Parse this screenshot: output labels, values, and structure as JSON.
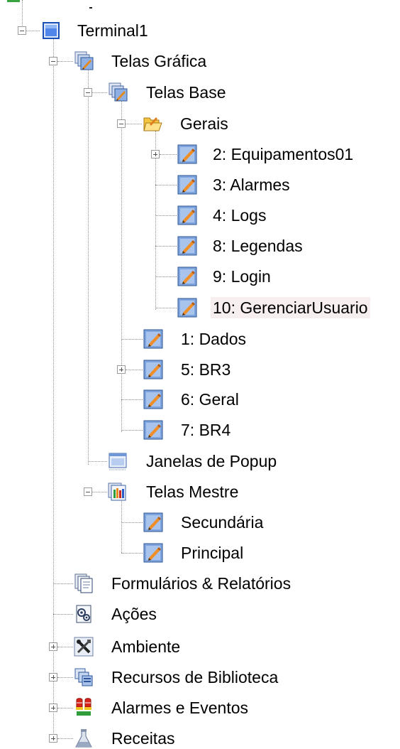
{
  "tree": {
    "root": {
      "label": "Terminal1"
    },
    "telas_grafica": {
      "label": "Telas Gráfica"
    },
    "telas_base": {
      "label": "Telas Base"
    },
    "gerais": {
      "label": "Gerais"
    },
    "items_gerais": [
      {
        "label": "2: Equipamentos01"
      },
      {
        "label": "3: Alarmes"
      },
      {
        "label": "4: Logs"
      },
      {
        "label": "8: Legendas"
      },
      {
        "label": "9: Login"
      },
      {
        "label": "10: GerenciarUsuario"
      }
    ],
    "items_base": [
      {
        "label": "1: Dados"
      },
      {
        "label": "5: BR3"
      },
      {
        "label": "6: Geral"
      },
      {
        "label": "7: BR4"
      }
    ],
    "janelas_popup": {
      "label": "Janelas de Popup"
    },
    "telas_mestre": {
      "label": "Telas Mestre"
    },
    "items_mestre": [
      {
        "label": "Secundária"
      },
      {
        "label": "Principal"
      }
    ],
    "formularios": {
      "label": "Formulários & Relatórios"
    },
    "acoes": {
      "label": "Ações"
    },
    "ambiente": {
      "label": "Ambiente"
    },
    "recursos": {
      "label": "Recursos de Biblioteca"
    },
    "alarmes_eventos": {
      "label": "Alarmes e Eventos"
    },
    "receitas": {
      "label": "Receitas"
    }
  }
}
